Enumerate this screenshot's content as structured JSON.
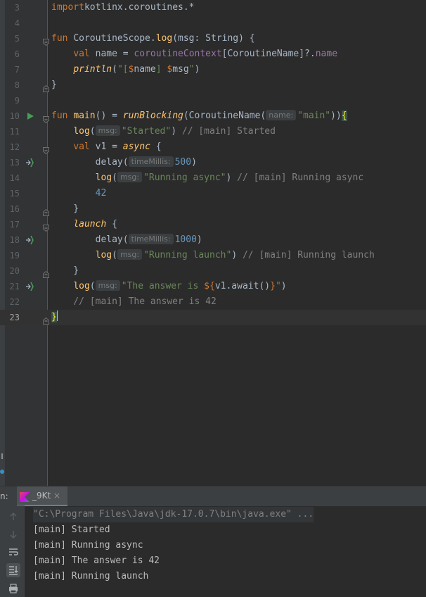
{
  "editor": {
    "lines": [
      {
        "num": "3",
        "segments": [
          [
            "kw",
            "import"
          ],
          [
            "",
            "kotlinx.coroutines.*"
          ]
        ]
      },
      {
        "num": "4",
        "segments": []
      },
      {
        "num": "5",
        "segments": [
          [
            "kw",
            "fun "
          ],
          [
            "",
            "CoroutineScope."
          ],
          [
            "fn",
            "log"
          ],
          [
            "",
            "(msg: String) {"
          ]
        ]
      },
      {
        "num": "6",
        "segments": [
          [
            "",
            "    "
          ],
          [
            "kw",
            "val "
          ],
          [
            "",
            "name = "
          ],
          [
            "prop",
            "coroutineContext"
          ],
          [
            "",
            "[CoroutineName]?."
          ],
          [
            "prop",
            "name"
          ]
        ]
      },
      {
        "num": "7",
        "segments": [
          [
            "",
            "    "
          ],
          [
            "ext",
            "println"
          ],
          [
            "",
            "("
          ],
          [
            "str",
            "\"["
          ],
          [
            "kw",
            "$"
          ],
          [
            "",
            "name"
          ],
          [
            "str",
            "] "
          ],
          [
            "kw",
            "$"
          ],
          [
            "",
            "msg"
          ],
          [
            "str",
            "\""
          ],
          [
            "",
            ")"
          ]
        ]
      },
      {
        "num": "8",
        "segments": [
          [
            "",
            "}"
          ]
        ]
      },
      {
        "num": "9",
        "segments": []
      },
      {
        "num": "10",
        "segments": [
          [
            "kw",
            "fun "
          ],
          [
            "fn",
            "main"
          ],
          [
            "",
            "() = "
          ],
          [
            "ext",
            "runBlocking"
          ],
          [
            "",
            "(CoroutineName("
          ],
          [
            "hint",
            "name:"
          ],
          [
            "str",
            "\"main\""
          ],
          [
            "",
            "))"
          ],
          [
            "braceHL",
            "{"
          ]
        ]
      },
      {
        "num": "11",
        "segments": [
          [
            "",
            "    "
          ],
          [
            "fn",
            "log"
          ],
          [
            "",
            "("
          ],
          [
            "hint",
            "msg:"
          ],
          [
            "str",
            "\"Started\""
          ],
          [
            "",
            ")"
          ],
          [
            "cmt",
            " // [main] Started"
          ]
        ]
      },
      {
        "num": "12",
        "segments": [
          [
            "",
            "    "
          ],
          [
            "kw",
            "val "
          ],
          [
            "",
            "v1 = "
          ],
          [
            "ext",
            "async"
          ],
          [
            "",
            " {"
          ]
        ]
      },
      {
        "num": "13",
        "segments": [
          [
            "",
            "        delay("
          ],
          [
            "hint",
            "timeMillis:"
          ],
          [
            "num",
            "500"
          ],
          [
            "",
            ")"
          ]
        ]
      },
      {
        "num": "14",
        "segments": [
          [
            "",
            "        "
          ],
          [
            "fn",
            "log"
          ],
          [
            "",
            "("
          ],
          [
            "hint",
            "msg:"
          ],
          [
            "str",
            "\"Running async\""
          ],
          [
            "",
            ")"
          ],
          [
            "cmt",
            " // [main] Running async"
          ]
        ]
      },
      {
        "num": "15",
        "segments": [
          [
            "",
            "        "
          ],
          [
            "num",
            "42"
          ]
        ]
      },
      {
        "num": "16",
        "segments": [
          [
            "",
            "    }"
          ]
        ]
      },
      {
        "num": "17",
        "segments": [
          [
            "",
            "    "
          ],
          [
            "ext",
            "launch"
          ],
          [
            "",
            " {"
          ]
        ]
      },
      {
        "num": "18",
        "segments": [
          [
            "",
            "        delay("
          ],
          [
            "hint",
            "timeMillis:"
          ],
          [
            "num",
            "1000"
          ],
          [
            "",
            ")"
          ]
        ]
      },
      {
        "num": "19",
        "segments": [
          [
            "",
            "        "
          ],
          [
            "fn",
            "log"
          ],
          [
            "",
            "("
          ],
          [
            "hint",
            "msg:"
          ],
          [
            "str",
            "\"Running launch\""
          ],
          [
            "",
            ")"
          ],
          [
            "cmt",
            " // [main] Running launch"
          ]
        ]
      },
      {
        "num": "20",
        "segments": [
          [
            "",
            "    }"
          ]
        ]
      },
      {
        "num": "21",
        "segments": [
          [
            "",
            "    "
          ],
          [
            "fn",
            "log"
          ],
          [
            "",
            "("
          ],
          [
            "hint",
            "msg:"
          ],
          [
            "str",
            "\"The answer is "
          ],
          [
            "kw",
            "${"
          ],
          [
            "",
            "v1.await()"
          ],
          [
            "kw",
            "}"
          ],
          [
            "str",
            "\""
          ],
          [
            "",
            ")"
          ]
        ]
      },
      {
        "num": "22",
        "segments": [
          [
            "cmt",
            "    // [main] The answer is 42"
          ]
        ]
      },
      {
        "num": "23",
        "segments": [
          [
            "braceHL",
            "}"
          ],
          [
            "caret",
            ""
          ]
        ]
      }
    ]
  },
  "run": {
    "panel_label": "n:",
    "tab_label": "_9Kt",
    "tab_close": "×",
    "output_lines": [
      "\"C:\\Program Files\\Java\\jdk-17.0.7\\bin\\java.exe\" ...",
      "[main] Started",
      "[main] Running async",
      "[main] The answer is 42",
      "[main] Running launch"
    ]
  },
  "colors": {
    "background": "#2b2b2b",
    "gutter": "#313335",
    "keyword": "#cc7832",
    "function": "#ffc66d",
    "string": "#6a8759",
    "number": "#6897bb",
    "comment": "#808080",
    "property": "#9876aa",
    "run_icon": "#499c54"
  }
}
